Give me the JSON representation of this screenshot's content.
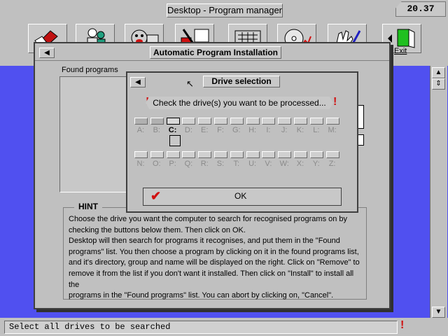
{
  "desktop": {
    "title": "Desktop - Program manager",
    "clock": "20.37"
  },
  "toolbar": {
    "icons": [
      "install-icon",
      "people-icon",
      "face-drive-icon",
      "tools-icon",
      "keyboard-icon",
      "disc-icon",
      "hand-pen-icon",
      "exit-icon"
    ],
    "exit_label": "Exit"
  },
  "main_dialog": {
    "title": "Automatic Program Installation",
    "found_programs_label": "Found programs",
    "hint_label": "HINT",
    "hint_lines": [
      "Choose the drive you want the computer to search for recognised programs on by",
      "checking the buttons below them. Then click on OK.",
      "Desktop will then search for programs it recognises, and put them in the \"Found",
      "programs\" list. You then choose a program by clicking on it in the found programs list,",
      "and it's directory, group and name will be displayed on the right. Click on \"Remove\" to",
      "remove it from the list if you don't want it installed. Then click on \"Install\" to install all the",
      "programs in the \"Found programs\" list. You can abort by clicking on, \"Cancel\"."
    ]
  },
  "drive_dialog": {
    "title": "Drive selection",
    "prompt": "Check the drive(s) you want to be processed...",
    "row1": [
      "A:",
      "B:",
      "C:",
      "D:",
      "E:",
      "F:",
      "G:",
      "H:",
      "I:",
      "J:",
      "K:",
      "L:",
      "M:"
    ],
    "row2": [
      "N:",
      "O:",
      "P:",
      "Q:",
      "R:",
      "S:",
      "T:",
      "U:",
      "V:",
      "W:",
      "X:",
      "Y:",
      "Z:"
    ],
    "present_drives": [
      "A:",
      "B:",
      "C:"
    ],
    "selected_drive": "C:",
    "ok_label": "OK"
  },
  "status": {
    "text": "Select all drives to be searched"
  },
  "colors": {
    "desktop_blue": "#5050f0",
    "alert_red": "#d01010",
    "panel_gray": "#c0c0c0"
  }
}
